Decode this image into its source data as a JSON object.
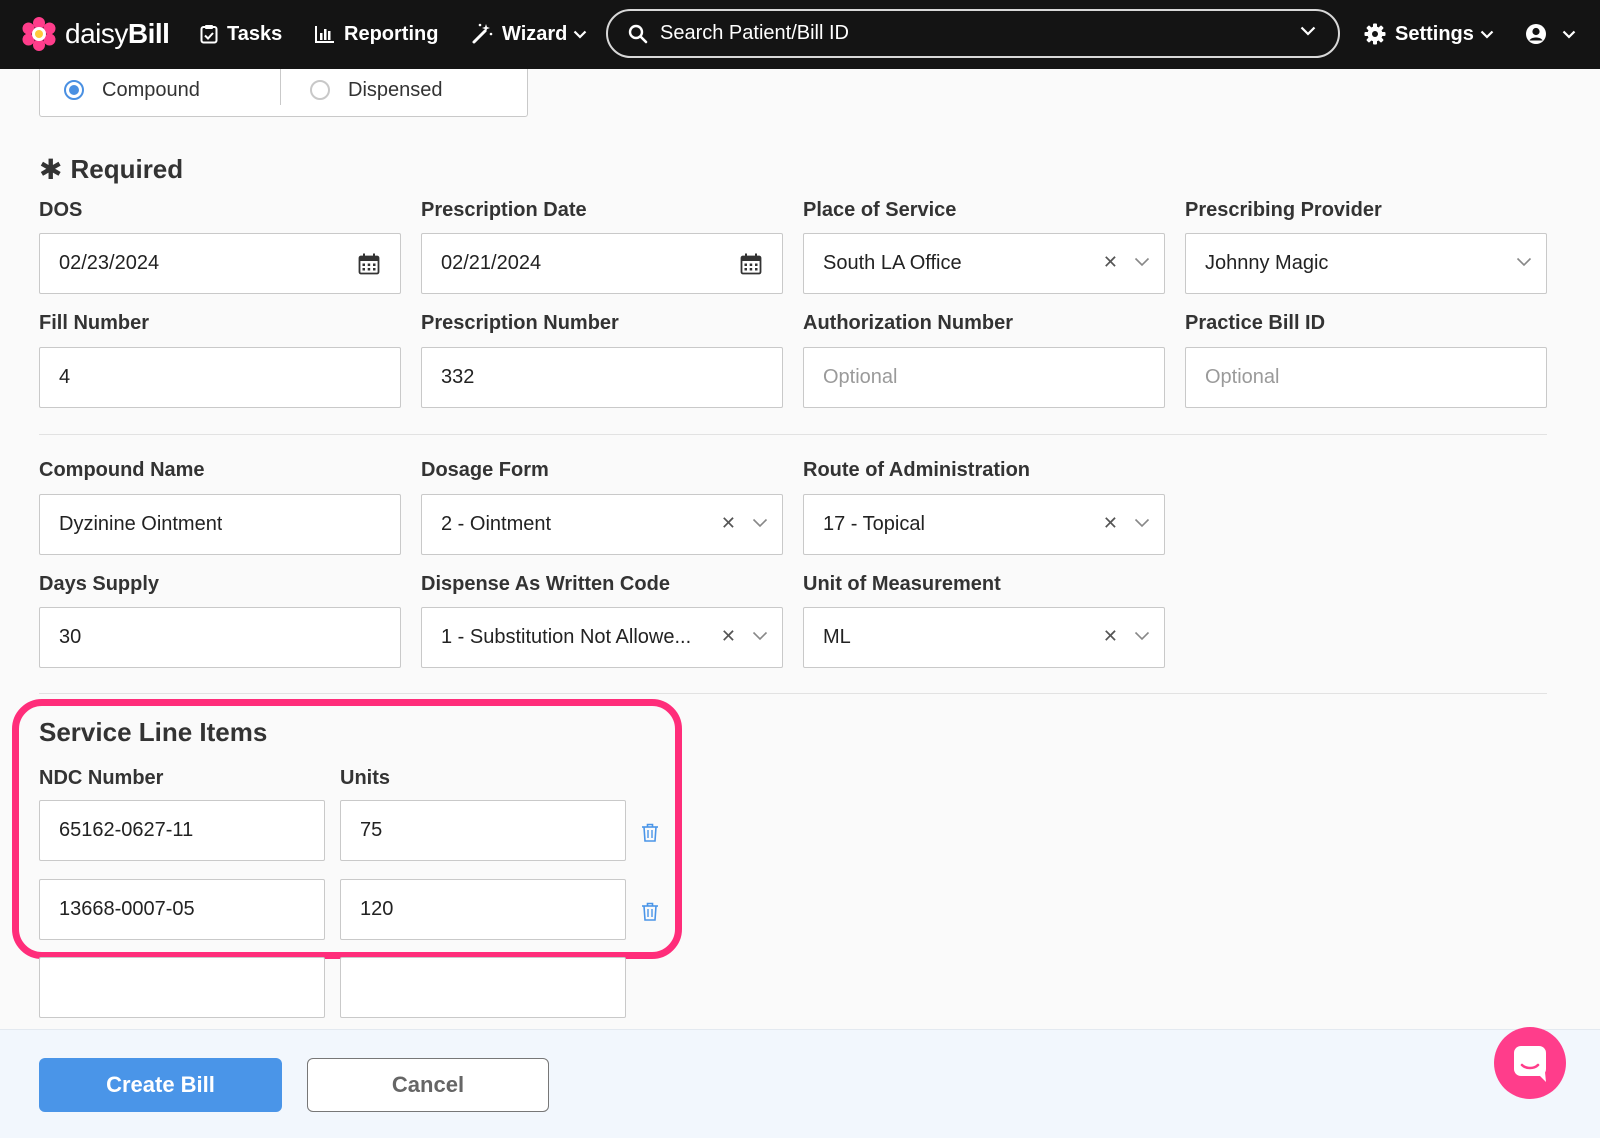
{
  "app": {
    "brand_light": "daisy",
    "brand_bold": "Bill"
  },
  "nav": {
    "tasks": "Tasks",
    "reporting": "Reporting",
    "wizard": "Wizard",
    "search_placeholder": "Search Patient/Bill ID",
    "settings": "Settings"
  },
  "type_options": [
    {
      "label": "Compound",
      "checked": true
    },
    {
      "label": "Dispensed",
      "checked": false
    }
  ],
  "required_title": "Required",
  "fields": {
    "dos": {
      "label": "DOS",
      "value": "02/23/2024"
    },
    "prescription_date": {
      "label": "Prescription Date",
      "value": "02/21/2024"
    },
    "place_of_service": {
      "label": "Place of Service",
      "value": "South LA Office"
    },
    "prescribing_provider": {
      "label": "Prescribing Provider",
      "value": "Johnny Magic"
    },
    "fill_number": {
      "label": "Fill Number",
      "value": "4"
    },
    "prescription_number": {
      "label": "Prescription Number",
      "value": "332"
    },
    "authorization_number": {
      "label": "Authorization Number",
      "placeholder": "Optional"
    },
    "practice_bill_id": {
      "label": "Practice Bill ID",
      "placeholder": "Optional"
    },
    "compound_name": {
      "label": "Compound Name",
      "value": "Dyzinine Ointment"
    },
    "dosage_form": {
      "label": "Dosage Form",
      "value": "2 - Ointment"
    },
    "route_of_administration": {
      "label": "Route of Administration",
      "value": "17 - Topical"
    },
    "days_supply": {
      "label": "Days Supply",
      "value": "30"
    },
    "dispense_as_written": {
      "label": "Dispense As Written Code",
      "value": "1 - Substitution Not Allowe..."
    },
    "unit_of_measurement": {
      "label": "Unit of Measurement",
      "value": "ML"
    }
  },
  "service_lines": {
    "title": "Service Line Items",
    "ndc_label": "NDC Number",
    "units_label": "Units",
    "rows": [
      {
        "ndc": "65162-0627-11",
        "units": "75"
      },
      {
        "ndc": "13668-0007-05",
        "units": "120"
      },
      {
        "ndc": "",
        "units": ""
      }
    ]
  },
  "footer": {
    "create_label": "Create Bill",
    "cancel_label": "Cancel"
  },
  "colors": {
    "accent": "#4a95e8",
    "highlight": "#ff2d7a",
    "nav_bg": "#141414",
    "chat": "#ff3d8b"
  }
}
